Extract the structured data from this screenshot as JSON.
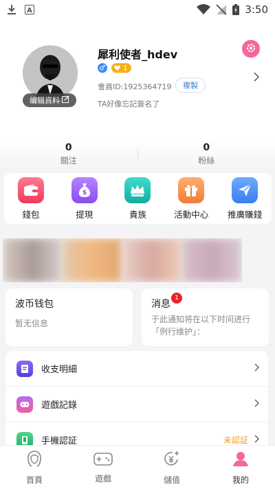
{
  "status_bar": {
    "time": "3:50"
  },
  "profile": {
    "username": "犀利使者_hdev",
    "edit_label": "编辑資料",
    "level": "1",
    "member_id": "會員ID:1925364719",
    "copy_label": "複製",
    "signature": "TA好像忘記簽名了"
  },
  "stats": [
    {
      "value": "0",
      "label": "關注"
    },
    {
      "value": "0",
      "label": "粉絲"
    }
  ],
  "quick_actions": [
    {
      "label": "錢包",
      "color": "#f24a66"
    },
    {
      "label": "提現",
      "color": "#9b5ef0"
    },
    {
      "label": "貴族",
      "color": "#18c3b8"
    },
    {
      "label": "活動中心",
      "color": "#f7904a"
    },
    {
      "label": "推廣賺錢",
      "color": "#4a8ef5"
    }
  ],
  "cards": {
    "wallet": {
      "title": "波币钱包",
      "subtitle": "暂无信息"
    },
    "messages": {
      "title": "消息",
      "count": "1",
      "subtitle": "于此通知将在以下时间进行「例行维护」："
    }
  },
  "menu": [
    {
      "label": "收支明細",
      "status": ""
    },
    {
      "label": "遊戲記錄",
      "status": ""
    },
    {
      "label": "手機認証",
      "status": "未認証"
    }
  ],
  "tabs": [
    {
      "label": "首頁"
    },
    {
      "label": "遊戲"
    },
    {
      "label": "儲值"
    },
    {
      "label": "我的"
    }
  ],
  "colors": {
    "accent_pink": "#f5679c",
    "level_gold": "#f5b11c",
    "link_blue": "#3b7fd4",
    "warning_orange": "#f3a020"
  }
}
